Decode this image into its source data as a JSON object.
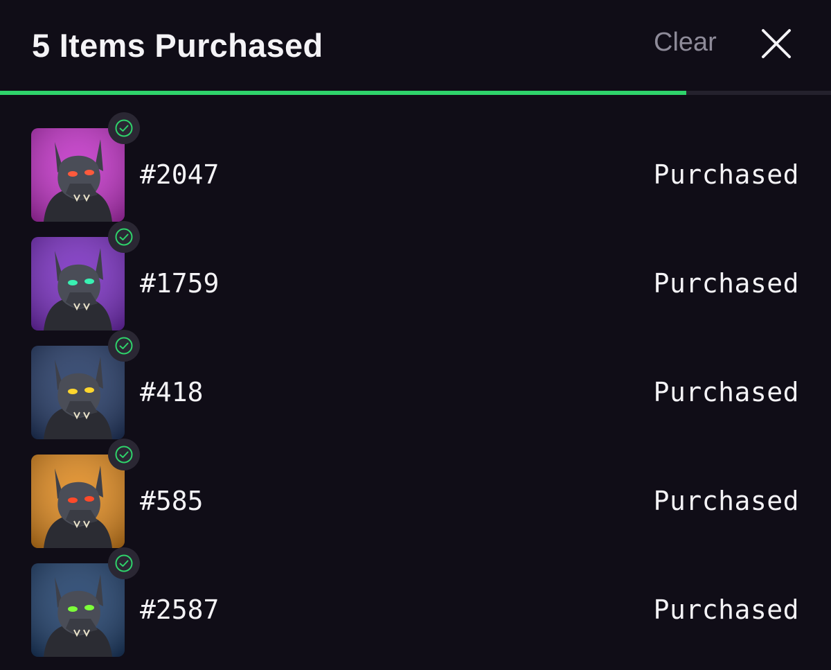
{
  "header": {
    "title": "5 Items Purchased",
    "clear_label": "Clear",
    "close_icon": "close-icon"
  },
  "progress": {
    "fraction": 0.826,
    "color": "#2fd36b"
  },
  "items": [
    {
      "name": "#2047",
      "status": "Purchased",
      "bg": "#c233c7",
      "eye": "#ff5a3c",
      "icon": "check-circle-icon"
    },
    {
      "name": "#1759",
      "status": "Purchased",
      "bg": "#7a2fc2",
      "eye": "#39f0b2",
      "icon": "check-circle-icon"
    },
    {
      "name": "#418",
      "status": "Purchased",
      "bg": "#243a66",
      "eye": "#ffd62e",
      "icon": "check-circle-icon"
    },
    {
      "name": "#585",
      "status": "Purchased",
      "bg": "#e08a1f",
      "eye": "#ff4a2a",
      "icon": "check-circle-icon"
    },
    {
      "name": "#2587",
      "status": "Purchased",
      "bg": "#1f3f6b",
      "eye": "#7dff3a",
      "icon": "check-circle-icon"
    }
  ]
}
